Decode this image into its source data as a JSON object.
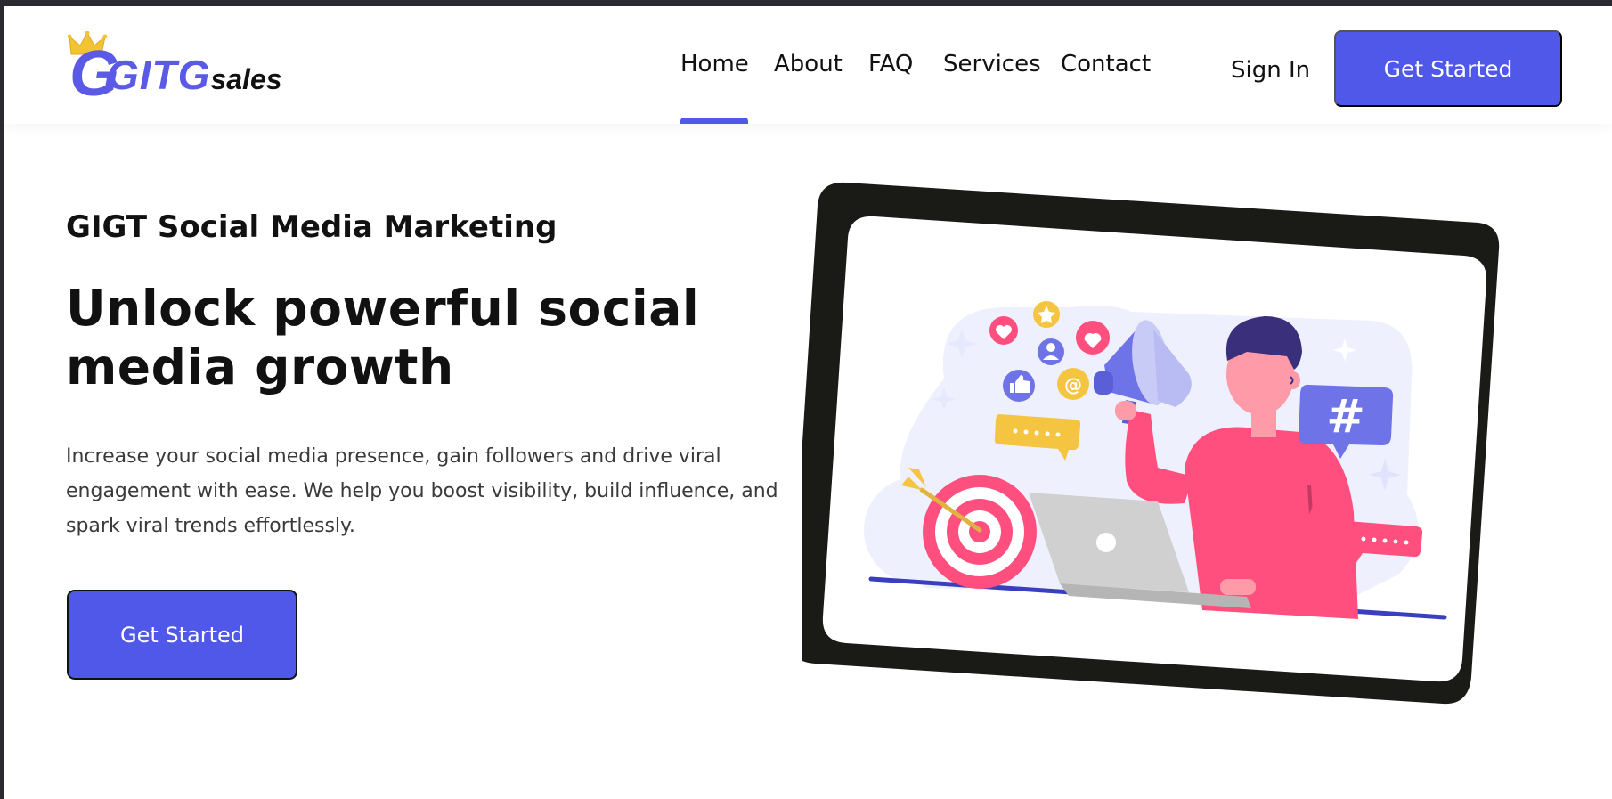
{
  "brand": {
    "logo_text": "GITG",
    "logo_suffix": "sales",
    "colors": {
      "accent": "#4f58e8",
      "text": "#111111",
      "frame": "#1a1a16",
      "pink": "#ff4f7e"
    }
  },
  "nav": {
    "items": [
      {
        "label": "Home",
        "active": true
      },
      {
        "label": "About",
        "active": false
      },
      {
        "label": "FAQ",
        "active": false
      },
      {
        "label": "Services",
        "active": false
      },
      {
        "label": "Contact",
        "active": false
      }
    ],
    "sign_in_label": "Sign In",
    "cta_label": "Get Started"
  },
  "hero": {
    "eyebrow": "GIGT Social Media Marketing",
    "headline_line1": "Unlock powerful social",
    "headline_line2": "media growth",
    "description": "Increase your social media presence, gain followers and drive viral engagement with ease. We help you boost visibility, build influence, and spark viral trends effortlessly.",
    "cta_label": "Get Started",
    "illustration": {
      "icons": [
        "heart-icon",
        "star-icon",
        "user-icon",
        "thumbs-up-icon",
        "at-sign-icon",
        "megaphone-icon",
        "hashtag-icon",
        "target-icon",
        "laptop-icon",
        "chat-bubble-icon"
      ]
    }
  }
}
